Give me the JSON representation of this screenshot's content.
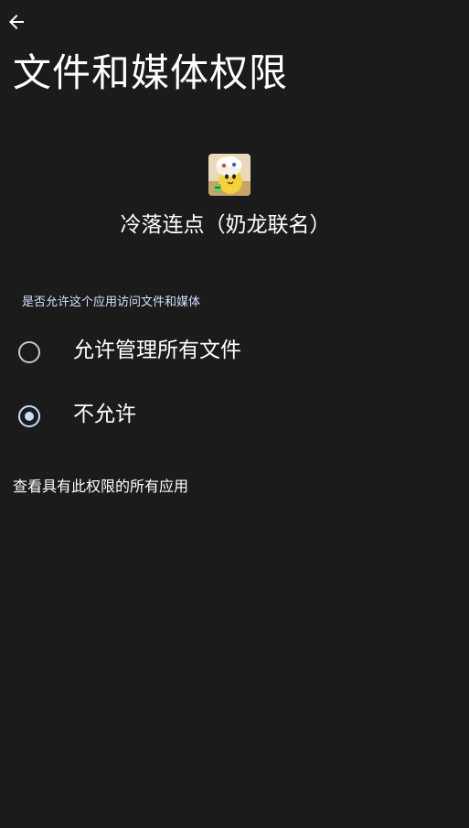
{
  "header": {
    "back_icon": "arrow-back-icon",
    "title": "文件和媒体权限"
  },
  "app": {
    "icon": "app-icon",
    "name": "冷落连点（奶龙联名）"
  },
  "permission": {
    "question": "是否允许这个应用访问文件和媒体",
    "options": [
      {
        "label": "允许管理所有文件",
        "selected": false
      },
      {
        "label": "不允许",
        "selected": true
      }
    ]
  },
  "footer": {
    "link_label": "查看具有此权限的所有应用"
  },
  "colors": {
    "background": "#1b1b1c",
    "accent": "#c9dcff",
    "radio_unchecked": "#c5c6cc",
    "text": "#ffffff"
  }
}
